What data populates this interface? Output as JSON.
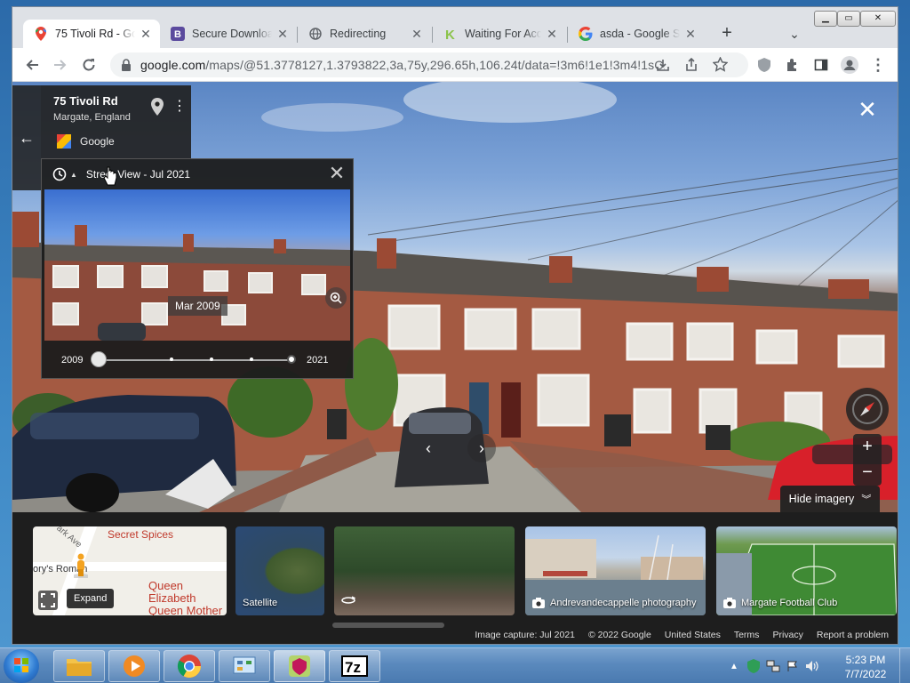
{
  "browser": {
    "tabs": [
      {
        "title": "75 Tivoli Rd - Google Maps",
        "icon": "google-maps-icon",
        "active": true
      },
      {
        "title": "Secure Download",
        "icon": "b-letter-icon",
        "active": false
      },
      {
        "title": "Redirecting",
        "icon": "globe-icon",
        "active": false
      },
      {
        "title": "Waiting For Access",
        "icon": "k-letter-icon",
        "active": false
      },
      {
        "title": "asda - Google Search",
        "icon": "google-icon",
        "active": false
      }
    ],
    "url_host": "google.com",
    "url_path": "/maps/@51.3778127,1.3793822,3a,75y,296.65h,106.24t/data=!3m6!1e1!3m4!1sC...",
    "window_controls": [
      "minimize",
      "maximize",
      "close"
    ]
  },
  "streetview": {
    "address_title": "75 Tivoli Rd",
    "address_subtitle": "Margate, England",
    "provider": "Google",
    "timemachine": {
      "header": "Street View - Jul 2021",
      "thumb_date": "Mar 2009",
      "year_start": "2009",
      "year_end": "2021",
      "selected_fraction": 0.0
    },
    "hide_imagery_label": "Hide imagery"
  },
  "strip": {
    "map_card": {
      "poi_1": "Secret Spices",
      "poi_2_line1": "Queen Elizabeth",
      "poi_2_line2": "Queen Mother H",
      "street": "ark Ave",
      "partial": "ory's Roman",
      "expand_label": "Expand"
    },
    "cards": [
      {
        "label": "Satellite"
      },
      {
        "label": ""
      },
      {
        "label": "Andrevandecappelle photography"
      },
      {
        "label": "Margate Football Club"
      }
    ],
    "attribution": [
      "Image capture: Jul 2021",
      "© 2022 Google",
      "United States",
      "Terms",
      "Privacy",
      "Report a problem"
    ]
  },
  "taskbar": {
    "time": "5:23 PM",
    "date": "7/7/2022",
    "apps": [
      "explorer",
      "media-player",
      "chrome",
      "control-panel",
      "shield-app",
      "7zip"
    ],
    "sevenzip_label": "7z"
  },
  "colors": {
    "chrome_bg": "#dee1e6",
    "maps_red": "#ea4335",
    "taskbar_blue": "#5a89bd"
  }
}
